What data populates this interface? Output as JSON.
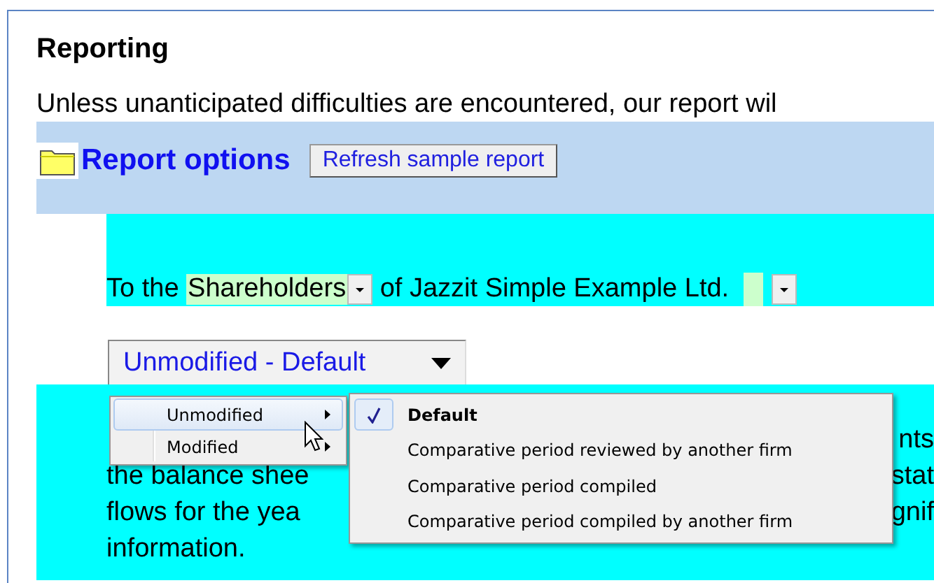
{
  "heading": "Reporting",
  "intro": "Unless unanticipated difficulties are encountered, our report wil",
  "report_options": {
    "title": "Report options",
    "refresh_button": "Refresh sample report"
  },
  "addressee": {
    "prefix": "To the",
    "recipient": "Shareholders",
    "middle": "of Jazzit Simple Example Ltd."
  },
  "opinion_combo": {
    "value": "Unmodified - Default"
  },
  "paragraph_fragments": [
    {
      "right": "nts"
    },
    {
      "left": "the balance shee",
      "right": "stat"
    },
    {
      "left": "flows for the yea",
      "right": "gnif"
    },
    {
      "left": "information."
    }
  ],
  "menu": {
    "items": [
      {
        "label": "Unmodified",
        "selected": true
      },
      {
        "label": "Modified",
        "selected": false
      }
    ],
    "submenu": [
      {
        "label": "Default",
        "checked": true
      },
      {
        "label": "Comparative period reviewed by another firm",
        "checked": false
      },
      {
        "label": "Comparative period compiled",
        "checked": false
      },
      {
        "label": "Comparative period compiled by another firm",
        "checked": false
      }
    ]
  }
}
